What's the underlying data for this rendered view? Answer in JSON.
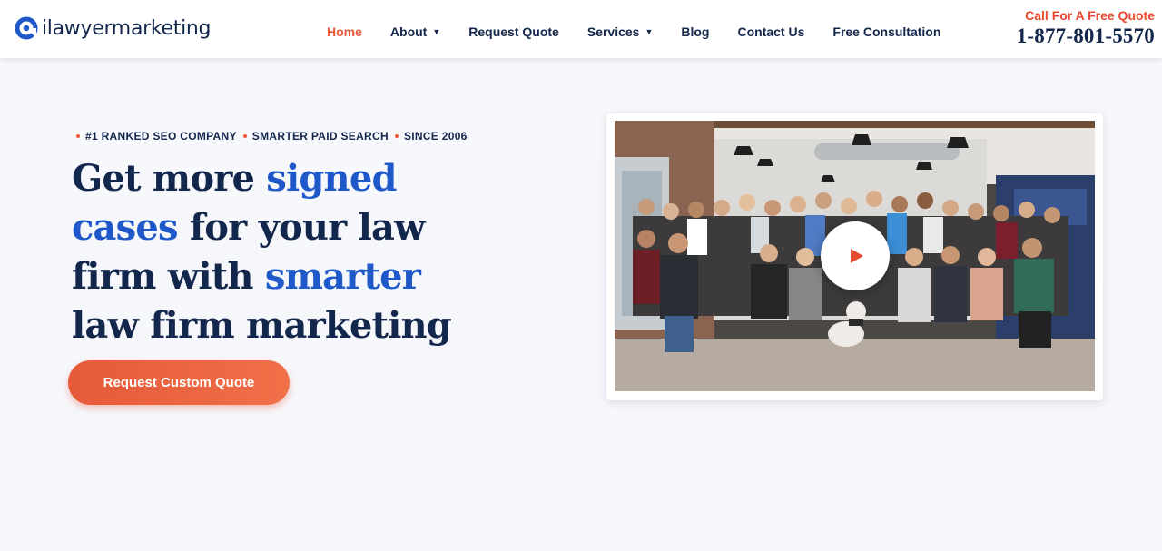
{
  "brand": {
    "name": "ilawyermarketing",
    "accent": "#e8593c",
    "navy": "#13264b",
    "blue": "#1f58c9"
  },
  "nav": {
    "items": [
      {
        "label": "Home",
        "active": true,
        "dropdown": false
      },
      {
        "label": "About",
        "active": false,
        "dropdown": true
      },
      {
        "label": "Request Quote",
        "active": false,
        "dropdown": false
      },
      {
        "label": "Services",
        "active": false,
        "dropdown": true
      },
      {
        "label": "Blog",
        "active": false,
        "dropdown": false
      },
      {
        "label": "Contact Us",
        "active": false,
        "dropdown": false
      },
      {
        "label": "Free Consultation",
        "active": false,
        "dropdown": false
      }
    ],
    "caret_icon": "chevron-down-icon"
  },
  "call": {
    "label": "Call For A Free Quote",
    "phone": "1-877-801-5570"
  },
  "hero": {
    "eyebrow": [
      "#1 RANKED SEO COMPANY",
      "SMARTER PAID SEARCH",
      "SINCE 2006"
    ],
    "headline": {
      "p1": "Get more ",
      "h1": "signed",
      "p2": " ",
      "h2": "cases",
      "p3": " for your law firm with ",
      "h3": "smarter",
      "p4": " law firm marketing"
    },
    "cta_label": "Request Custom Quote"
  },
  "video": {
    "play_icon": "play-icon",
    "content": "team-photo"
  }
}
